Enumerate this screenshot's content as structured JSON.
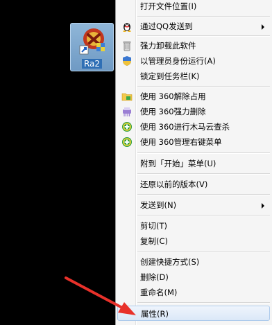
{
  "desktop": {
    "shortcut_label": "Ra2"
  },
  "menu": {
    "items": [
      {
        "label": "打开文件位置(I)"
      },
      {
        "label": "通过QQ发送到",
        "icon": "qq-penguin-icon",
        "submenu": true
      },
      {
        "label": "强力卸载此软件",
        "icon": "trash-icon"
      },
      {
        "label": "以管理员身份运行(A)",
        "icon": "uac-shield-icon"
      },
      {
        "label": "锁定到任务栏(K)"
      },
      {
        "label": "使用 360解除占用",
        "icon": "folder-unlock-icon"
      },
      {
        "label": "使用 360强力删除",
        "icon": "purple-shred-icon"
      },
      {
        "label": "使用 360进行木马云查杀",
        "icon": "360-green-plus-icon"
      },
      {
        "label": "使用 360管理右键菜单",
        "icon": "360-green-plus-icon"
      },
      {
        "label": "附到「开始」菜单(U)"
      },
      {
        "label": "还原以前的版本(V)"
      },
      {
        "label": "发送到(N)",
        "submenu": true
      },
      {
        "label": "剪切(T)"
      },
      {
        "label": "复制(C)"
      },
      {
        "label": "创建快捷方式(S)"
      },
      {
        "label": "删除(D)"
      },
      {
        "label": "重命名(M)"
      },
      {
        "label": "属性(R)"
      }
    ]
  },
  "colors": {
    "annotation_arrow": "#e8312a",
    "highlight": "#dbe8f8"
  }
}
